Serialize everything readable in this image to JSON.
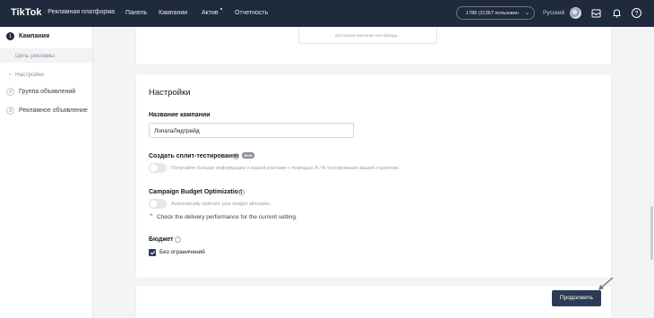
{
  "topbar": {
    "logo": "TikTok",
    "logo_suffix": "· Рекламная платформа",
    "nav": [
      "Панель",
      "Кампании",
      "Актив",
      "Отчетность"
    ],
    "account": "1788 (31367 пользован",
    "language": "Русский",
    "icons": [
      "avatar",
      "inbox-icon",
      "bell-icon",
      "help-icon"
    ]
  },
  "sidebar": {
    "steps": [
      {
        "num": "1",
        "label": "Кампания",
        "current": true
      },
      {
        "num": "2",
        "label": "Группа объявлений"
      },
      {
        "num": "3",
        "label": "Рекламное объявление"
      }
    ],
    "substeps": [
      "Цель рекламы",
      "Настройки"
    ]
  },
  "main": {
    "inner_box_text": "для вашей компании или бренда...",
    "section_title": "Настройки",
    "campaign_name_label": "Название кампании",
    "campaign_name_value": "ЛопатаЛидтрейд",
    "split_test_label": "Создать сплит-тестирование",
    "split_test_badge": "NEW",
    "split_test_hint": "Получайте больше информации о вашей рекламе с помощью A / B-тестирования вашей стратегии.",
    "cbo_label": "Campaign Budget Optimization",
    "cbo_hint": "Automatically optimize your budget allocation.",
    "delivery_note": "Check the delivery performance for the current setting.",
    "budget_label": "Бюджет",
    "budget_unlimited": "Без ограничений",
    "continue_button": "Продолжить"
  },
  "colors": {
    "topbar": "#1f2a3d",
    "button": "#2b3a55"
  }
}
